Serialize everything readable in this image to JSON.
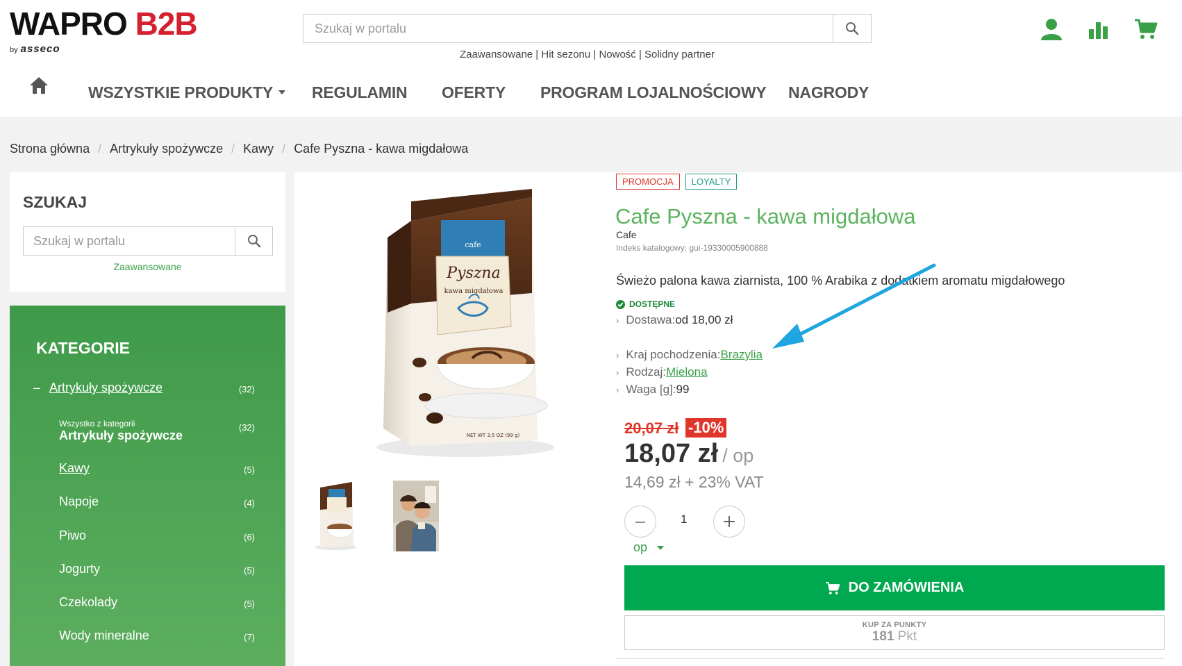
{
  "brand": {
    "name_main": "WAPRO ",
    "name_accent": "B2B",
    "by": "by",
    "company": "asseco",
    "accent_color": "#d4202f"
  },
  "header": {
    "search_placeholder": "Szukaj w portalu",
    "quick_links": "Zaawansowane | Hit sezonu | Nowość | Solidny partner",
    "icons": [
      "user-icon",
      "chart-icon",
      "cart-icon"
    ]
  },
  "nav": {
    "home_icon": "home-icon",
    "items": [
      {
        "label": "WSZYSTKIE PRODUKTY",
        "has_dropdown": true
      },
      {
        "label": "REGULAMIN"
      },
      {
        "label": "OFERTY"
      },
      {
        "label": "PROGRAM LOJALNOŚCIOWY"
      },
      {
        "label": "NAGRODY"
      }
    ]
  },
  "breadcrumb": [
    "Strona główna",
    "Artrykuły spożywcze",
    "Kawy",
    "Cafe Pyszna - kawa migdałowa"
  ],
  "sidebar": {
    "search_title": "SZUKAJ",
    "search_placeholder": "Szukaj w portalu",
    "advanced_link": "Zaawansowane",
    "categories_title": "KATEGORIE",
    "categories": [
      {
        "prefix": "–",
        "label": "Artrykuły spożywcze",
        "count": "(32)"
      },
      {
        "small": "Wszystko z kategorii",
        "label": "Artrykuły spożywcze",
        "count": "(32)"
      },
      {
        "label": "Kawy",
        "count": "(5)"
      },
      {
        "label": "Napoje",
        "count": "(4)"
      },
      {
        "label": "Piwo",
        "count": "(6)"
      },
      {
        "label": "Jogurty",
        "count": "(5)"
      },
      {
        "label": "Czekolady",
        "count": "(5)"
      },
      {
        "label": "Wody mineralne",
        "count": "(7)"
      }
    ],
    "gradient_color": "#3e9a49"
  },
  "product": {
    "badges": [
      "PROMOCJA",
      "LOYALTY"
    ],
    "title": "Cafe Pyszna - kawa migdałowa",
    "brand": "Cafe",
    "catalog_index": "Indeks katalogowy: gui-19330005900888",
    "description": "Świeżo palona kawa ziarnista, 100 % Arabika z dodatkiem aromatu migdałowego",
    "availability": "DOSTĘPNE",
    "attributes": [
      {
        "label": "Dostawa: ",
        "value": "od 18,00 zł",
        "link": false
      },
      {
        "label": "Kraj pochodzenia: ",
        "value": "Brazylia",
        "link": true
      },
      {
        "label": "Rodzaj: ",
        "value": "Mielona",
        "link": true
      },
      {
        "label": "Waga [g]: ",
        "value": "99",
        "link": false
      }
    ],
    "package_text": {
      "brand": "cafe",
      "name": "Pyszna",
      "variant": "kawa migdałowa",
      "weight": "NET WT 3.5 OZ (99 g)"
    },
    "old_price": "20,07 zł",
    "discount": "-10%",
    "price": "18,07 zł",
    "price_unit": "/ op",
    "net_price": "14,69 zł + 23% VAT",
    "quantity": "1",
    "unit": "op",
    "order_button": "DO ZAMÓWIENIA",
    "points_label": "KUP ZA PUNKTY",
    "points_value": "181",
    "points_unit": " Pkt",
    "green": "#00a84f",
    "title_color": "#5cb35f"
  }
}
